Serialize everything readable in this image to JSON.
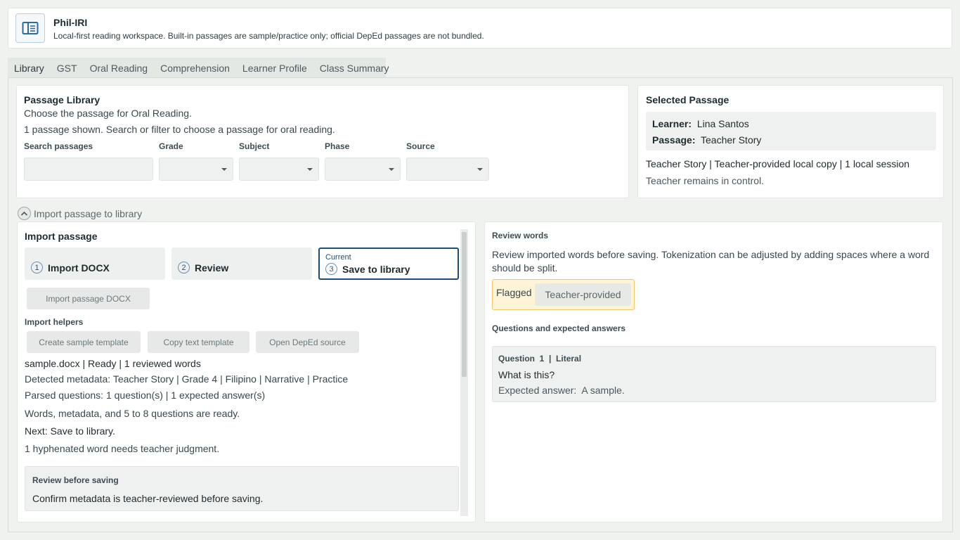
{
  "header": {
    "title": "Phil-IRI",
    "subtitle": "Local-first reading workspace. Built-in passages are sample/practice only; official DepEd passages are not bundled.",
    "icon": "book-panel-icon"
  },
  "tabs": [
    {
      "label": "Library",
      "active": true
    },
    {
      "label": "GST"
    },
    {
      "label": "Oral Reading"
    },
    {
      "label": "Comprehension"
    },
    {
      "label": "Learner Profile"
    },
    {
      "label": "Class Summary"
    }
  ],
  "library": {
    "title": "Passage Library",
    "subtitle": "Choose the passage for Oral Reading.",
    "status": "1 passage shown. Search or filter to choose a passage for oral reading.",
    "filters": {
      "search_label": "Search passages",
      "search_value": "",
      "grade_label": "Grade",
      "subject_label": "Subject",
      "phase_label": "Phase",
      "source_label": "Source"
    }
  },
  "selected": {
    "title": "Selected Passage",
    "learner_key": "Learner:",
    "learner_value": "Lina Santos",
    "passage_key": "Passage:",
    "passage_value": "Teacher Story",
    "meta": "Teacher Story | Teacher-provided local copy | 1 local session",
    "note": "Teacher remains in control."
  },
  "import_toggle": {
    "label": "Import passage to library",
    "icon": "chevron-up-icon"
  },
  "import": {
    "title": "Import passage",
    "steps": [
      {
        "num": "1",
        "label": "Import DOCX"
      },
      {
        "num": "2",
        "label": "Review"
      },
      {
        "num": "3",
        "label": "Save to library",
        "current_label": "Current"
      }
    ],
    "import_button": "Import passage DOCX",
    "helpers_label": "Import helpers",
    "helpers": [
      "Create sample template",
      "Copy text template",
      "Open DepEd source"
    ],
    "file_status": "sample.docx | Ready | 1 reviewed words",
    "metadata": "Detected metadata: Teacher Story | Grade 4 | Filipino | Narrative | Practice",
    "parsed": "Parsed questions: 1 question(s) | 1 expected answer(s)",
    "ready": "Words, metadata, and 5 to 8 questions are ready.",
    "next": "Next: Save to library.",
    "hyphen_note": "1 hyphenated word needs teacher judgment.",
    "review_title": "Review before saving",
    "review_text": "Confirm metadata is teacher-reviewed before saving."
  },
  "review_words": {
    "title": "Review words",
    "description": "Review imported words before saving. Tokenization can be adjusted by adding spaces where a word should be split.",
    "flag_label": "Flagged",
    "chip": "Teacher-provided",
    "questions_title": "Questions and expected answers",
    "question_head": "Question  1  |  Literal",
    "question_text": "What is this?",
    "answer_key": "Expected answer:",
    "answer_value": "A sample."
  },
  "colors": {
    "accent": "#1f4d73",
    "flag_bg": "#fff3d8",
    "flag_border": "#f0c46a"
  }
}
